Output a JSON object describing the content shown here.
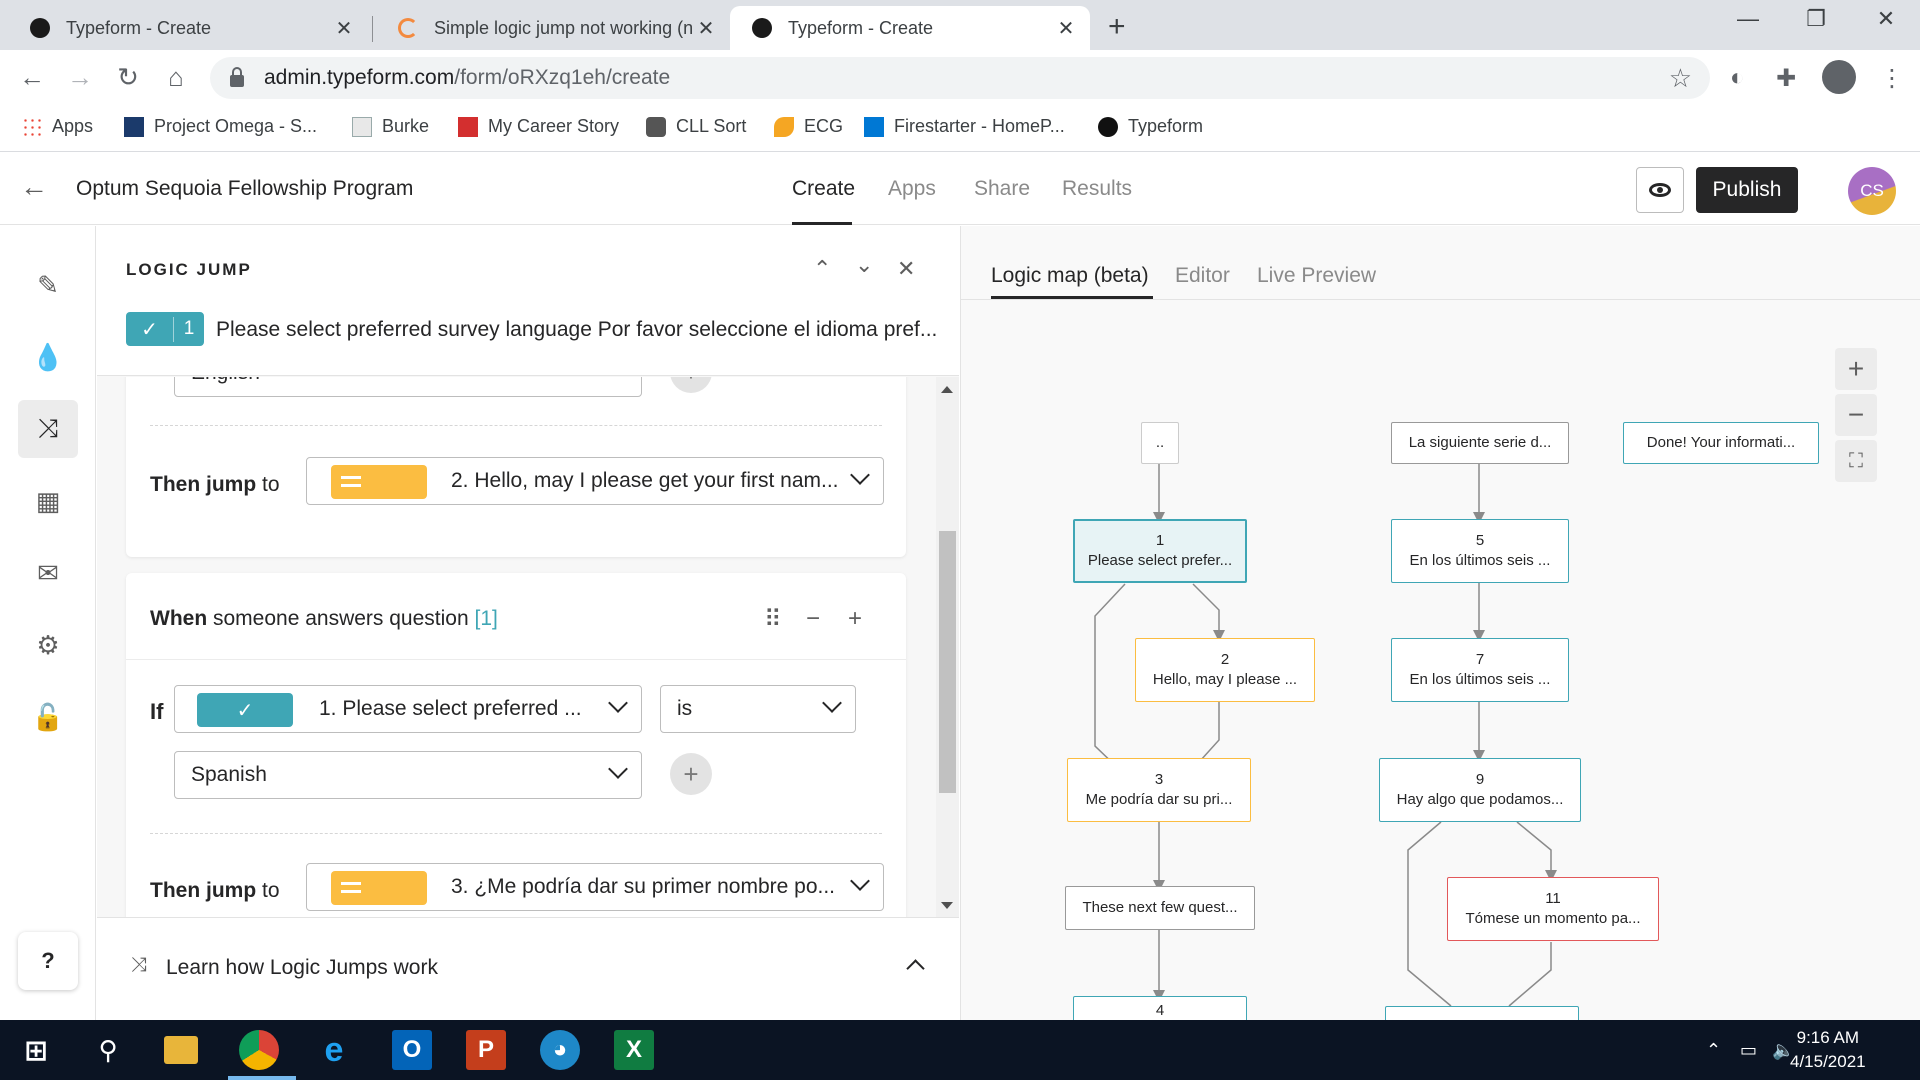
{
  "browser": {
    "tabs": [
      {
        "title": "Typeform - Create",
        "active": false
      },
      {
        "title": "Simple logic jump not working (n",
        "active": false
      },
      {
        "title": "Typeform - Create",
        "active": true
      }
    ],
    "url_host": "admin.typeform.com",
    "url_path": "/form/oRXzq1eh/create",
    "bookmarks": [
      "Apps",
      "Project Omega - S...",
      "Burke",
      "My Career Story",
      "CLL Sort",
      "ECG",
      "Firestarter - HomeP...",
      "Typeform"
    ]
  },
  "app": {
    "form_title": "Optum Sequoia Fellowship Program",
    "nav": [
      "Create",
      "Apps",
      "Share",
      "Results"
    ],
    "active_nav": "Create",
    "publish_label": "Publish",
    "avatar_initials": "CS"
  },
  "logic_panel": {
    "title": "LOGIC JUMP",
    "question_number": "1",
    "question_title": "Please select preferred survey language Por favor seleccione el idioma pref...",
    "block1": {
      "answer_value": "English",
      "then_label_bold": "Then jump",
      "then_label_rest": "to",
      "jump_target": "2. Hello, may I please get your first nam..."
    },
    "block2": {
      "when_bold": "When",
      "when_rest": "someone answers question",
      "question_ref": "[1]",
      "if_label": "If",
      "condition_question": "1. Please select preferred ...",
      "operator": "is",
      "answer_value": "Spanish",
      "then_label_bold": "Then jump",
      "then_label_rest": "to",
      "jump_target": "3. ¿Me podría dar su primer nombre po..."
    },
    "learn_label": "Learn how Logic Jumps work",
    "help_label": "?"
  },
  "right_panel": {
    "tabs": [
      "Logic map (beta)",
      "Editor",
      "Live Preview"
    ],
    "active_tab": "Logic map (beta)",
    "nodes": [
      {
        "id": "welcome",
        "num": "",
        "text": ".."
      },
      {
        "id": "q1",
        "num": "1",
        "text": "Please select prefer..."
      },
      {
        "id": "q2",
        "num": "2",
        "text": "Hello, may I please ..."
      },
      {
        "id": "q3",
        "num": "3",
        "text": "Me podría dar su pri..."
      },
      {
        "id": "stmt",
        "num": "",
        "text": "These next few quest..."
      },
      {
        "id": "q4",
        "num": "4",
        "text": ""
      },
      {
        "id": "stmt2",
        "num": "",
        "text": "La siguiente serie d..."
      },
      {
        "id": "q5",
        "num": "5",
        "text": "En los últimos seis ..."
      },
      {
        "id": "q7",
        "num": "7",
        "text": "En los últimos seis ..."
      },
      {
        "id": "q9",
        "num": "9",
        "text": "Hay algo que podamos..."
      },
      {
        "id": "q11",
        "num": "11",
        "text": "Tómese un momento pa..."
      },
      {
        "id": "thanks",
        "num": "",
        "text": "Done! Your informati..."
      }
    ]
  },
  "taskbar": {
    "time": "9:16 AM",
    "date": "4/15/2021"
  },
  "colors": {
    "teal": "#3fa6b5",
    "yellow": "#fbbd41",
    "red": "#e2585a",
    "publish_bg": "#262627"
  }
}
